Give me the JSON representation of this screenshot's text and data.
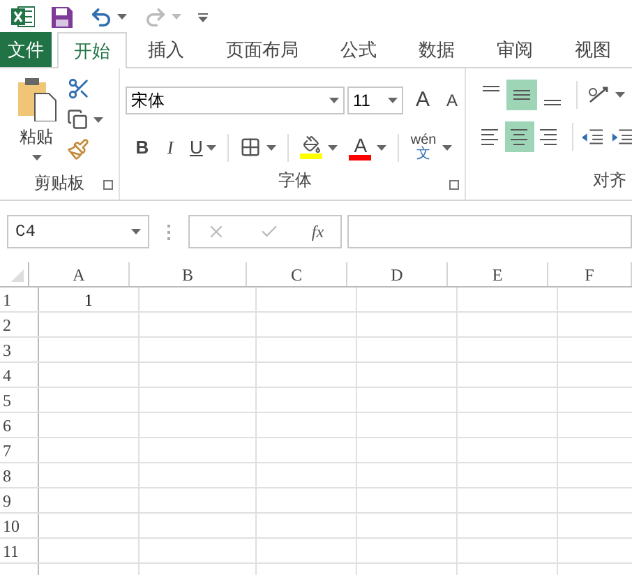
{
  "tabs": [
    {
      "label": "文件",
      "kind": "file",
      "selected": false
    },
    {
      "label": "开始",
      "kind": "tab",
      "selected": true
    },
    {
      "label": "插入",
      "kind": "tab",
      "selected": false
    },
    {
      "label": "页面布局",
      "kind": "tab",
      "selected": false
    },
    {
      "label": "公式",
      "kind": "tab",
      "selected": false
    },
    {
      "label": "数据",
      "kind": "tab",
      "selected": false
    },
    {
      "label": "审阅",
      "kind": "tab",
      "selected": false
    },
    {
      "label": "视图",
      "kind": "tab",
      "selected": false
    }
  ],
  "clipboard": {
    "label": "剪贴板",
    "paste": "粘贴"
  },
  "font": {
    "label": "字体",
    "font_name": "宋体",
    "font_size": "11",
    "grow": "A",
    "shrink": "A",
    "bold": "B",
    "italic": "I",
    "underline": "U",
    "font_color_letter": "A",
    "phonetic_top": "wén",
    "phonetic_bottom": "文"
  },
  "alignment": {
    "label": "对齐",
    "vertical": [
      {
        "selected": false
      },
      {
        "selected": true
      },
      {
        "selected": false
      }
    ],
    "horizontal": [
      {
        "selected": false
      },
      {
        "selected": true
      },
      {
        "selected": false
      }
    ]
  },
  "formula_bar": {
    "name_box": "C4",
    "fx": "fx"
  },
  "grid": {
    "columns": [
      "A",
      "B",
      "C",
      "D",
      "E",
      "F"
    ],
    "rows": [
      {
        "header": "1",
        "cells": [
          "1"
        ]
      },
      {
        "header": "2"
      },
      {
        "header": "3"
      },
      {
        "header": "4"
      },
      {
        "header": "5"
      },
      {
        "header": "6"
      },
      {
        "header": "7"
      },
      {
        "header": "8"
      },
      {
        "header": "9"
      },
      {
        "header": "10"
      },
      {
        "header": "11"
      }
    ]
  }
}
